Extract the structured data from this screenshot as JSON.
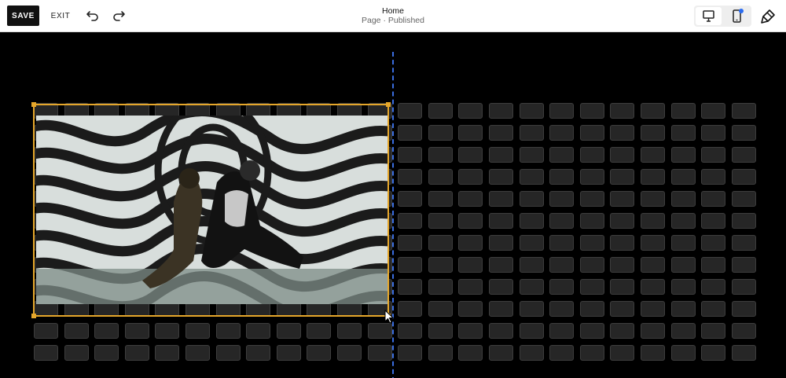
{
  "toolbar": {
    "save_label": "SAVE",
    "exit_label": "EXIT",
    "undo_icon": "undo-icon",
    "redo_icon": "redo-icon"
  },
  "page": {
    "title": "Home",
    "status": "Page · Published"
  },
  "devices": {
    "options": [
      "desktop",
      "mobile"
    ],
    "active": "desktop",
    "mobile_indicator_color": "#2b6cf0"
  },
  "design_icon": "paintbrush-icon",
  "canvas": {
    "background": "#000000",
    "grid_columns": 24,
    "grid_rows": 12,
    "center_guide_color": "#3a6ee0"
  },
  "selected_block": {
    "type": "video",
    "border_color": "#e6a72b",
    "content_description_icon": "video-thumbnail"
  }
}
